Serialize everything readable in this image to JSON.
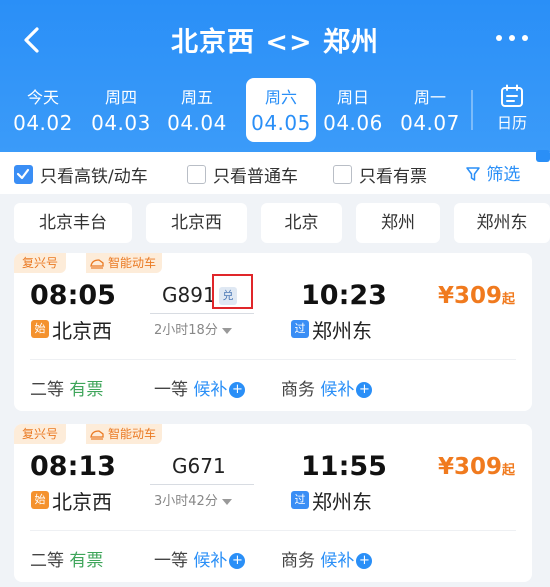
{
  "header": {
    "title": "北京西 <> 郑州",
    "back_icon": "chevron-left-icon",
    "more_icon": "more-dots-icon"
  },
  "dates": [
    {
      "weekday": "今天",
      "date": "04.02",
      "active": false
    },
    {
      "weekday": "周四",
      "date": "04.03",
      "active": false
    },
    {
      "weekday": "周五",
      "date": "04.04",
      "active": false
    },
    {
      "weekday": "周六",
      "date": "04.05",
      "active": true
    },
    {
      "weekday": "周日",
      "date": "04.06",
      "active": false
    },
    {
      "weekday": "周一",
      "date": "04.07",
      "active": false
    }
  ],
  "calendar": {
    "label": "日历",
    "icon": "calendar-icon"
  },
  "filters": [
    {
      "label": "只看高铁/动车",
      "checked": true
    },
    {
      "label": "只看普通车",
      "checked": false
    },
    {
      "label": "只看有票",
      "checked": false
    }
  ],
  "screen": {
    "label": "筛选",
    "icon": "filter-icon"
  },
  "stations": [
    "北京丰台",
    "北京西",
    "北京",
    "郑州",
    "郑州东"
  ],
  "trains": [
    {
      "tag_brand": "复兴号",
      "tag_smart": "智能动车",
      "dep_time": "08:05",
      "dep_badge": "始",
      "dep_station": "北京西",
      "train_no": "G891",
      "exchange_badge": "兑",
      "duration": "2小时18分",
      "arr_time": "10:23",
      "arr_badge": "过",
      "arr_station": "郑州东",
      "price": "¥309",
      "price_suffix": "起",
      "seats": [
        {
          "class": "二等",
          "status": "有票",
          "kind": "avail"
        },
        {
          "class": "一等",
          "status": "候补",
          "kind": "wait"
        },
        {
          "class": "商务",
          "status": "候补",
          "kind": "wait"
        }
      ]
    },
    {
      "tag_brand": "复兴号",
      "tag_smart": "智能动车",
      "dep_time": "08:13",
      "dep_badge": "始",
      "dep_station": "北京西",
      "train_no": "G671",
      "exchange_badge": "",
      "duration": "3小时42分",
      "arr_time": "11:55",
      "arr_badge": "过",
      "arr_station": "郑州东",
      "price": "¥309",
      "price_suffix": "起",
      "seats": [
        {
          "class": "二等",
          "status": "有票",
          "kind": "avail"
        },
        {
          "class": "一等",
          "status": "候补",
          "kind": "wait"
        },
        {
          "class": "商务",
          "status": "候补",
          "kind": "wait"
        }
      ]
    }
  ],
  "colors": {
    "brand_blue": "#2a8ff7",
    "price_orange": "#f07a1e",
    "available_green": "#3ea55a",
    "highlight_red": "#e0262a"
  }
}
